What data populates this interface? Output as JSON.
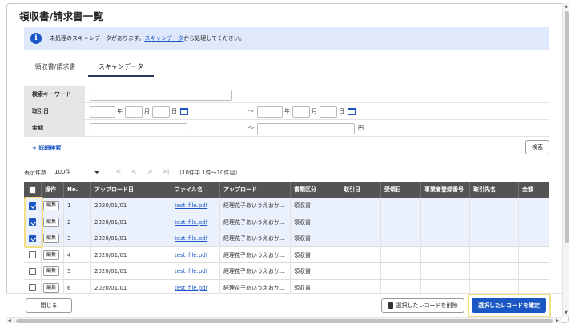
{
  "page": {
    "title": "領収書/請求書一覧"
  },
  "notice": {
    "prefix": "未処理のスキャンデータがあります。",
    "link": "スキャンデータ",
    "suffix": "から処理してください。"
  },
  "tabs": [
    {
      "label": "領収書/請求書",
      "active": false
    },
    {
      "label": "スキャンデータ",
      "active": true
    }
  ],
  "search_form": {
    "keyword_label": "検索キーワード",
    "date_label": "取引日",
    "amount_label": "金額",
    "year": "年",
    "month": "月",
    "day": "日",
    "tilde": "〜",
    "yen": "円",
    "detail_link": "+ 詳細検索",
    "search_button": "検索"
  },
  "pager": {
    "count_label": "表示件数",
    "count_value": "100件",
    "first": "|<",
    "prev": "<",
    "next": ">",
    "last": ">|",
    "range": "（10件中 1件〜10件目）"
  },
  "table": {
    "headers": [
      "",
      "操作",
      "No.",
      "アップロード日",
      "ファイル名",
      "アップロード",
      "書類区分",
      "取引日",
      "受領日",
      "事業者登録番号",
      "取引先名",
      "金額"
    ],
    "edit_label": "編集",
    "rows": [
      {
        "checked": true,
        "no": "1",
        "date": "2020/01/01",
        "file": "test_file.pdf",
        "uploader": "経理花子あいうえおか…",
        "type": "領収書"
      },
      {
        "checked": true,
        "no": "2",
        "date": "2020/01/01",
        "file": "test_file.pdf",
        "uploader": "経理花子あいうえおか…",
        "type": "領収書"
      },
      {
        "checked": true,
        "no": "3",
        "date": "2020/01/01",
        "file": "test_file.pdf",
        "uploader": "経理花子あいうえおか…",
        "type": "領収書"
      },
      {
        "checked": false,
        "no": "4",
        "date": "2020/01/01",
        "file": "test_file.pdf",
        "uploader": "経理花子あいうえおか…",
        "type": "領収書"
      },
      {
        "checked": false,
        "no": "5",
        "date": "2020/01/01",
        "file": "test_file.pdf",
        "uploader": "経理花子あいうえおか…",
        "type": "領収書"
      },
      {
        "checked": false,
        "no": "6",
        "date": "2020/01/01",
        "file": "test_file.pdf",
        "uploader": "経理花子あいうえおか…",
        "type": "領収書"
      }
    ]
  },
  "footer": {
    "close": "閉じる",
    "delete": "選択したレコードを削除",
    "confirm": "選択したレコードを確定"
  },
  "colors": {
    "accent": "#1a56c4",
    "highlight": "#f3de82",
    "header_bg": "#545454"
  }
}
